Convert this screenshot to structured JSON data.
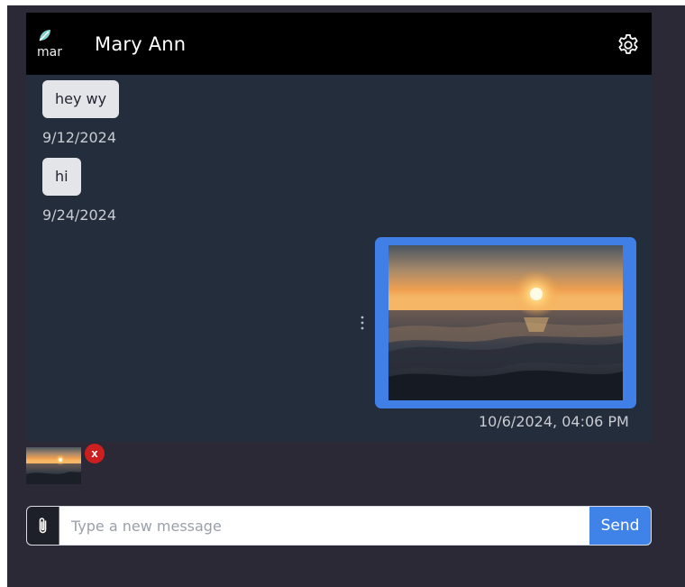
{
  "header": {
    "avatar_alt": "mar",
    "contact_name": "Mary Ann",
    "settings_icon": "gear-icon"
  },
  "messages": [
    {
      "text": "hey wy",
      "date": "9/12/2024",
      "direction": "incoming"
    },
    {
      "text": "hi",
      "date": "9/24/2024",
      "direction": "incoming"
    },
    {
      "type": "image",
      "image": "sunset-over-ocean-waves",
      "timestamp": "10/6/2024, 04:06 PM",
      "direction": "outgoing",
      "menu_icon": "kebab-icon"
    }
  ],
  "attachment_preview": {
    "image": "sunset-over-ocean-waves",
    "remove_label": "x"
  },
  "composer": {
    "attach_icon": "paperclip-icon",
    "placeholder": "Type a new message",
    "value": "",
    "send_label": "Send"
  },
  "colors": {
    "app_background": "#2a2935",
    "chat_background": "#232d3b",
    "header_background": "#000000",
    "bubble_incoming": "#e4e5e8",
    "bubble_outgoing": "#3f7fe6",
    "send_button": "#3f82e8",
    "remove_badge": "#cc1f1f"
  }
}
